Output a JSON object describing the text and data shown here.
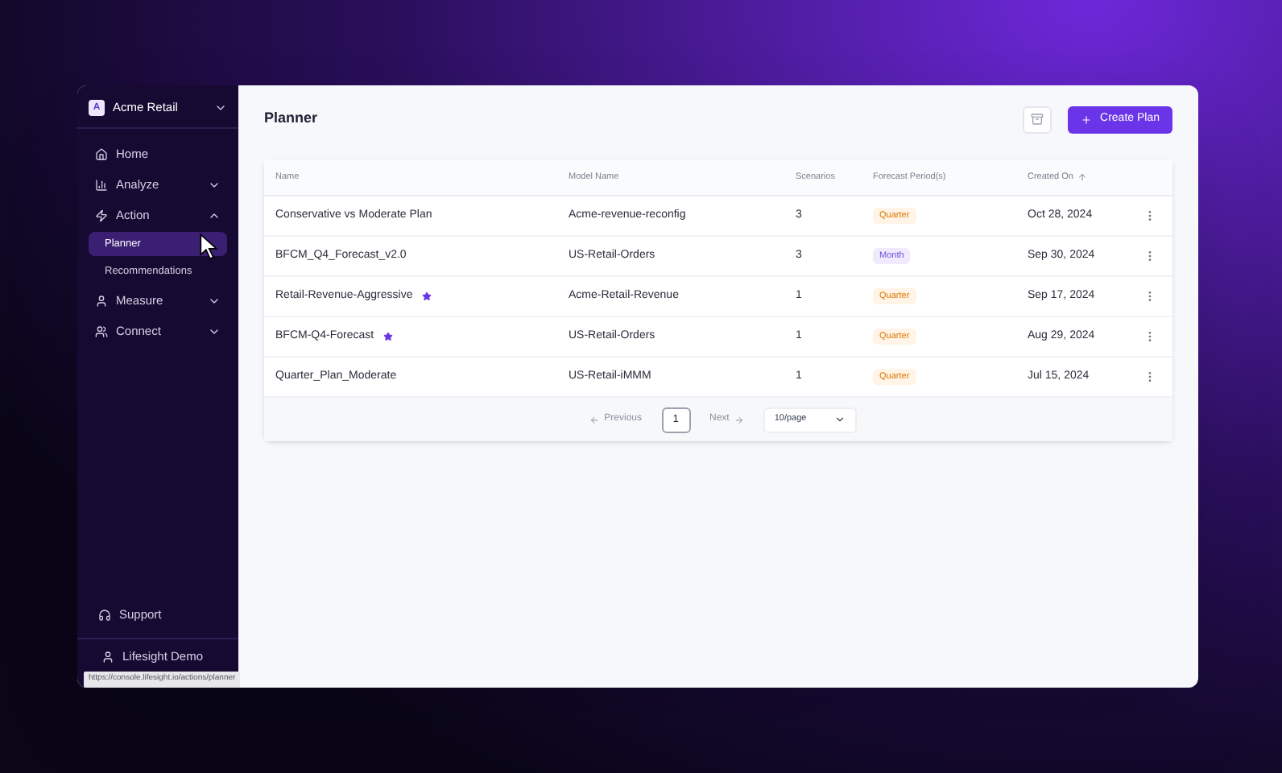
{
  "sidebar": {
    "workspace": {
      "logo": "A",
      "name": "Acme Retail"
    },
    "items": [
      {
        "label": "Home",
        "kind": "link",
        "selected": false
      },
      {
        "label": "Analyze",
        "kind": "group",
        "expanded": false,
        "selected": false
      },
      {
        "label": "Action",
        "kind": "group",
        "expanded": true,
        "selected": false,
        "children": [
          {
            "label": "Planner",
            "selected": true
          },
          {
            "label": "Recommendations",
            "selected": false
          }
        ]
      },
      {
        "label": "Measure",
        "kind": "group",
        "expanded": false,
        "selected": false
      },
      {
        "label": "Connect",
        "kind": "group",
        "expanded": false,
        "selected": false
      }
    ],
    "support": "Support",
    "user": "Lifesight Demo"
  },
  "page": {
    "title": "Planner",
    "create_button": "Create Plan"
  },
  "table": {
    "columns": [
      {
        "label": "Name",
        "sorted": false
      },
      {
        "label": "Model Name",
        "sorted": false
      },
      {
        "label": "Scenarios",
        "sorted": false
      },
      {
        "label": "Forecast Period(s)",
        "sorted": false
      },
      {
        "label": "Created On",
        "sorted": true
      }
    ],
    "rows": [
      {
        "name": "Conservative vs Moderate Plan",
        "starred": false,
        "model": "Acme-revenue-reconfig",
        "scenarios": "3",
        "period": {
          "label": "Quarter",
          "kind": "quarter"
        },
        "created": "Oct 28, 2024"
      },
      {
        "name": "BFCM_Q4_Forecast_v2.0",
        "starred": false,
        "model": "US-Retail-Orders",
        "scenarios": "3",
        "period": {
          "label": "Month",
          "kind": "month"
        },
        "created": "Sep 30, 2024"
      },
      {
        "name": "Retail-Revenue-Aggressive",
        "starred": true,
        "model": "Acme-Retail-Revenue",
        "scenarios": "1",
        "period": {
          "label": "Quarter",
          "kind": "quarter"
        },
        "created": "Sep 17, 2024"
      },
      {
        "name": "BFCM-Q4-Forecast",
        "starred": true,
        "model": "US-Retail-Orders",
        "scenarios": "1",
        "period": {
          "label": "Quarter",
          "kind": "quarter"
        },
        "created": "Aug 29, 2024"
      },
      {
        "name": "Quarter_Plan_Moderate",
        "starred": false,
        "model": "US-Retail-iMMM",
        "scenarios": "1",
        "period": {
          "label": "Quarter",
          "kind": "quarter"
        },
        "created": "Jul 15, 2024"
      }
    ]
  },
  "pagination": {
    "previous": {
      "label": "Previous",
      "disabled": true
    },
    "pages": [
      {
        "label": "1",
        "selected": true
      }
    ],
    "next": {
      "label": "Next",
      "disabled": true
    },
    "page_size": "10/page"
  },
  "status_url": "https://console.lifesight.io/actions/planner"
}
